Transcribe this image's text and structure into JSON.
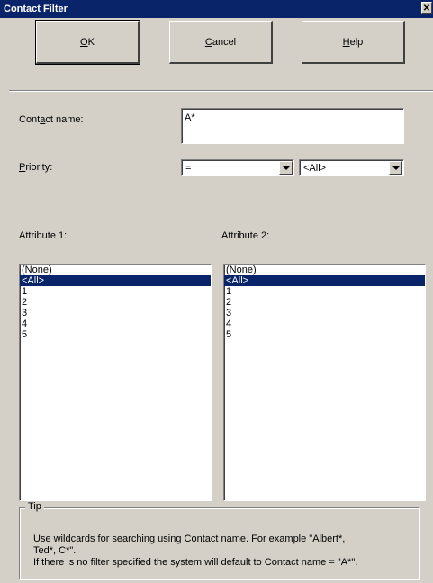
{
  "window": {
    "title": "Contact Filter",
    "close_glyph": "✕"
  },
  "buttons": {
    "ok": {
      "pre": "",
      "accel": "O",
      "post": "K"
    },
    "cancel": {
      "pre": "",
      "accel": "C",
      "post": "ancel"
    },
    "help": {
      "pre": "",
      "accel": "H",
      "post": "elp"
    }
  },
  "contact_name": {
    "pre": "Cont",
    "accel": "a",
    "post": "ct name:",
    "value": "A*"
  },
  "priority": {
    "pre": "",
    "accel": "P",
    "post": "riority:",
    "operator": "=",
    "level": "<All>"
  },
  "attribute1": {
    "label": "Attribute 1:",
    "items": [
      "(None)",
      "<All>",
      "1",
      "2",
      "3",
      "4",
      "5"
    ],
    "selected_index": 1
  },
  "attribute2": {
    "label": "Attribute 2:",
    "items": [
      "(None)",
      "<All>",
      "1",
      "2",
      "3",
      "4",
      "5"
    ],
    "selected_index": 1
  },
  "tip": {
    "legend": "Tip",
    "line1": "Use wildcards for searching using Contact name. For example \"Albert*,",
    "line2": "Ted*, C*\".",
    "line3": "If there is no filter specified the system will default to Contact name = \"A*\"."
  },
  "colors": {
    "titlebar": "#0a246a",
    "face": "#d4d0c8",
    "selection": "#0a246a"
  }
}
